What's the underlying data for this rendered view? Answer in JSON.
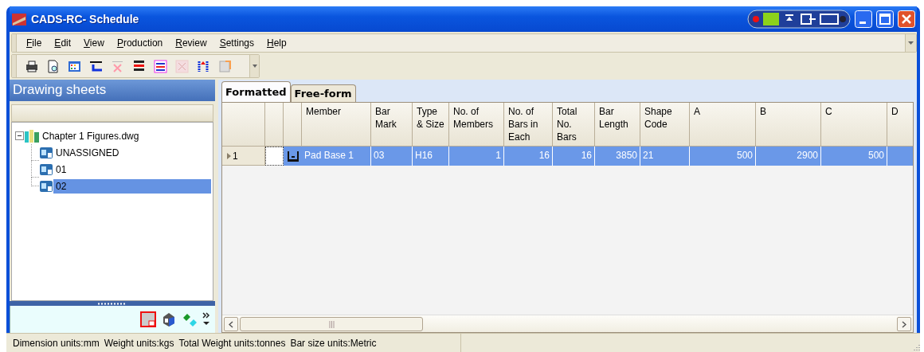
{
  "window": {
    "title": "CADS-RC- Schedule"
  },
  "menu": [
    "File",
    "Edit",
    "View",
    "Production",
    "Review",
    "Settings",
    "Help"
  ],
  "panel": {
    "title": "Drawing sheets",
    "tree": [
      {
        "label": "Chapter 1 Figures.dwg",
        "expanded": true,
        "selected": false,
        "children": [
          {
            "label": "UNASSIGNED",
            "selected": false
          },
          {
            "label": "01",
            "selected": false
          },
          {
            "label": "02",
            "selected": true
          }
        ]
      }
    ]
  },
  "tabs": [
    {
      "label": "Formatted",
      "selected": true
    },
    {
      "label": "Free-form",
      "selected": false
    }
  ],
  "table": {
    "columns": [
      {
        "label": "Member",
        "kind": "text"
      },
      {
        "label": "Bar Mark",
        "kind": "text"
      },
      {
        "label": "Type & Size",
        "kind": "text"
      },
      {
        "label": "No. of Members",
        "kind": "number"
      },
      {
        "label": "No. of Bars in Each",
        "kind": "number"
      },
      {
        "label": "Total No. Bars",
        "kind": "number"
      },
      {
        "label": "Bar Length",
        "kind": "number"
      },
      {
        "label": "Shape Code",
        "kind": "text"
      },
      {
        "label": "A",
        "kind": "number"
      },
      {
        "label": "B",
        "kind": "number"
      },
      {
        "label": "C",
        "kind": "number"
      },
      {
        "label": "D"
      }
    ],
    "rows": [
      {
        "number": "1",
        "selected": true,
        "cells": [
          "Pad Base 1",
          "03",
          "H16",
          "1",
          "16",
          "16",
          "3850",
          "21",
          "500",
          "2900",
          "500"
        ]
      }
    ]
  },
  "status_bar": [
    "Dimension units:mm",
    "Weight units:kgs",
    "Total Weight units:tonnes",
    "Bar size units:Metric"
  ]
}
